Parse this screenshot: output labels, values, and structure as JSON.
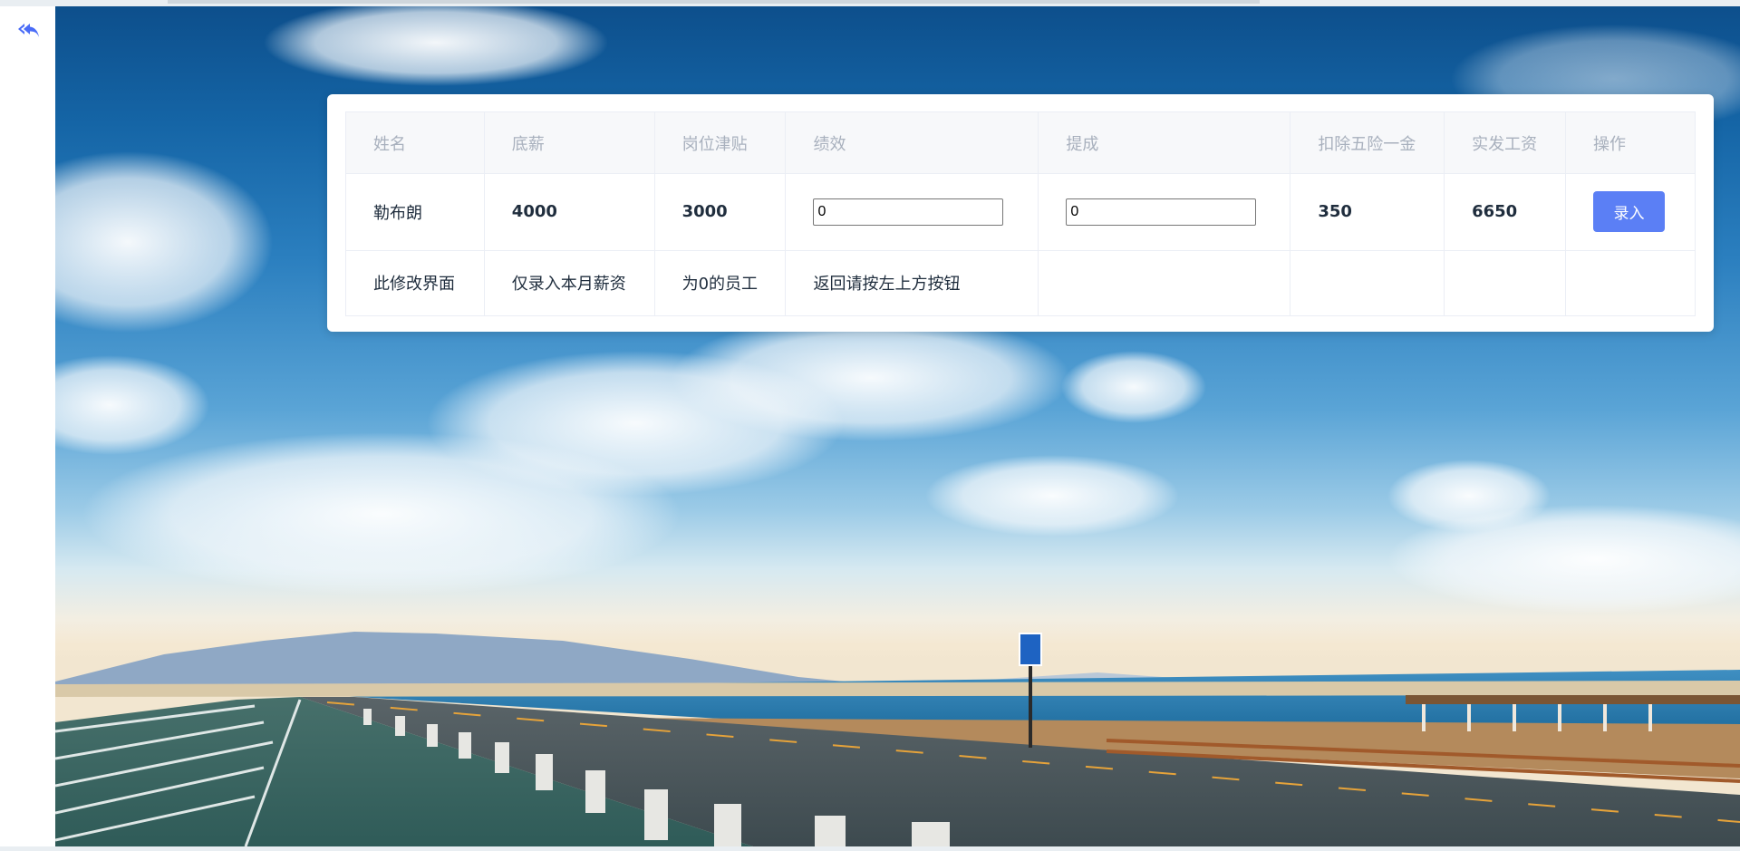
{
  "table": {
    "headers": [
      "姓名",
      "底薪",
      "岗位津贴",
      "绩效",
      "提成",
      "扣除五险一金",
      "实发工资",
      "操作"
    ],
    "row": {
      "name": "勒布朗",
      "base_salary": "4000",
      "post_allowance": "3000",
      "performance_value": "0",
      "commission_value": "0",
      "deduction": "350",
      "net_pay": "6650",
      "action_label": "录入"
    },
    "note": [
      "此修改界面",
      "仅录入本月薪资",
      "为0的员工",
      "返回请按左上方按钮"
    ]
  },
  "colors": {
    "primary_button": "#5b7ff5",
    "back_icon": "#4a6cf7",
    "header_text": "#a8b0bd"
  },
  "icons": {
    "back": "reply-all-icon"
  }
}
